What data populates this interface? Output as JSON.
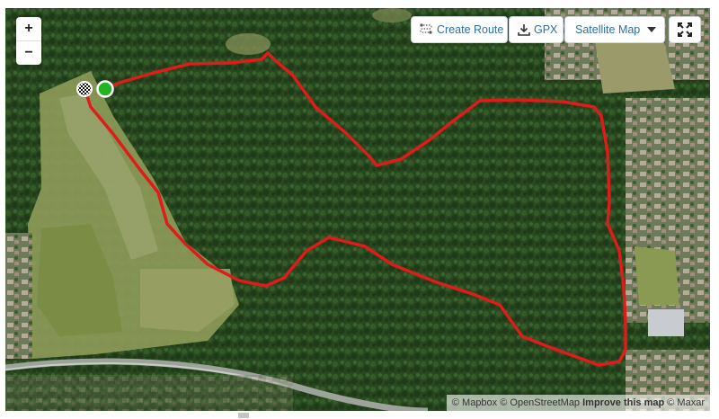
{
  "controls": {
    "zoom_in": "+",
    "zoom_out": "−",
    "create_route": "Create Route",
    "gpx": "GPX",
    "map_type": "Satellite Map",
    "fullscreen_icon": "expand-icon"
  },
  "attribution": {
    "mapbox": "© Mapbox",
    "osm": "© OpenStreetMap",
    "improve": "Improve this map",
    "maxar": "© Maxar"
  },
  "route": {
    "color": "#e01b1b",
    "start_marker_color": "#22b422",
    "finish_marker": "checkered-flag"
  },
  "colors": {
    "forest": "#2c4a20",
    "field": "#8f9a5a",
    "accent": "#2f6f9f"
  }
}
